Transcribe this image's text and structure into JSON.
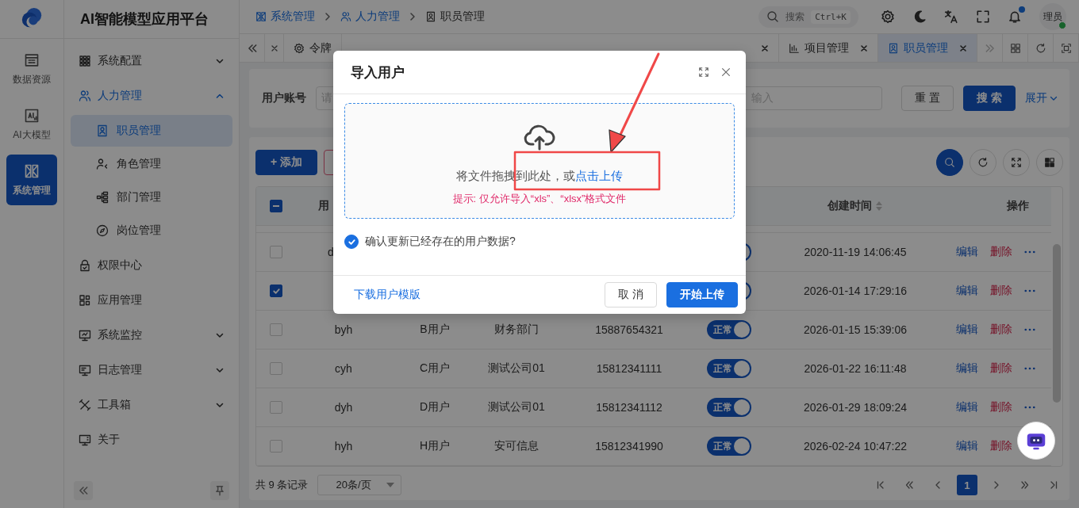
{
  "app": {
    "title": "AI智能模型应用平台"
  },
  "rail": [
    {
      "label": "数据资源",
      "selected": false
    },
    {
      "label": "AI大模型",
      "selected": false
    },
    {
      "label": "系统管理",
      "selected": true
    }
  ],
  "menu": [
    {
      "label": "系统配置",
      "selected": false,
      "expanded": false
    },
    {
      "label": "人力管理",
      "selected": true,
      "expanded": true,
      "children": [
        {
          "label": "职员管理",
          "selected": true
        },
        {
          "label": "角色管理",
          "selected": false
        },
        {
          "label": "部门管理",
          "selected": false
        },
        {
          "label": "岗位管理",
          "selected": false
        }
      ]
    },
    {
      "label": "权限中心",
      "selected": false
    },
    {
      "label": "应用管理",
      "selected": false
    },
    {
      "label": "系统监控",
      "selected": false,
      "expanded": false
    },
    {
      "label": "日志管理",
      "selected": false,
      "expanded": false
    },
    {
      "label": "工具箱",
      "selected": false,
      "expanded": false
    },
    {
      "label": "关于",
      "selected": false
    }
  ],
  "breadcrumbs": [
    "系统管理",
    "人力管理",
    "职员管理"
  ],
  "header": {
    "search_label": "搜索",
    "shortcut": "Ctrl+K",
    "notification_dot": true,
    "avatar": "理员",
    "online": true
  },
  "tabs": [
    {
      "label": "令牌",
      "selected": false,
      "closable": false
    },
    {
      "selected": false,
      "closable": true
    },
    {
      "label": "项目管理",
      "selected": false,
      "closable": true
    },
    {
      "label": "职员管理",
      "selected": true,
      "closable": true
    }
  ],
  "filters": {
    "account_label": "用户账号",
    "account_placeholder": "请",
    "field_2_placeholder": "输入",
    "reset": "重 置",
    "search": "搜 索",
    "expand": "展开"
  },
  "toolbar": {
    "add": "+ 添加"
  },
  "table": {
    "partially_selected": true,
    "column_account": "用",
    "column_created": "创建时间",
    "column_actions": "操作",
    "rows": [
      {
        "checked": false,
        "account": "d",
        "status": {
          "on": true
        },
        "created": "2020-11-19 14:06:45",
        "edit": "编辑",
        "delete": "删除"
      },
      {
        "checked": true,
        "status": {
          "on": true
        },
        "created": "2026-01-14 17:29:16",
        "edit": "编辑",
        "delete": "删除"
      },
      {
        "checked": false,
        "account": "byh",
        "name": "B用户",
        "dept": "财务部门",
        "phone": "15887654321",
        "status": {
          "on": true,
          "label": "正常"
        },
        "created": "2026-01-15 15:39:06",
        "edit": "编辑",
        "delete": "删除"
      },
      {
        "checked": false,
        "account": "cyh",
        "name": "C用户",
        "dept": "测试公司01",
        "phone": "15812341111",
        "status": {
          "on": true,
          "label": "正常"
        },
        "created": "2026-01-22 16:11:48",
        "edit": "编辑",
        "delete": "删除"
      },
      {
        "checked": false,
        "account": "dyh",
        "name": "D用户",
        "dept": "测试公司01",
        "phone": "15812341112",
        "status": {
          "on": true,
          "label": "正常"
        },
        "created": "2026-01-29 18:09:24",
        "edit": "编辑",
        "delete": "删除"
      },
      {
        "checked": false,
        "account": "hyh",
        "name": "H用户",
        "dept": "安可信息",
        "phone": "15812341990",
        "status": {
          "on": true,
          "label": "正常"
        },
        "created": "2026-02-24 10:47:22",
        "edit": "编辑",
        "delete": "删除"
      }
    ]
  },
  "pagination": {
    "total": "共 9 条记录",
    "page_size": "20条/页",
    "pages": [
      {
        "label": "1",
        "selected": true
      }
    ]
  },
  "dialog": {
    "title": "导入用户",
    "drop_text": "将文件拖拽到此处，或",
    "drop_link": "点击上传",
    "hint": "提示: 仅允许导入“xls”、“xlsx”格式文件",
    "update_existing": {
      "label": "确认更新已经存在的用户数据?",
      "checked": true
    },
    "template_link": "下载用户模版",
    "cancel": "取 消",
    "submit": "开始上传"
  },
  "annotation": {
    "arrow": true,
    "highlight": true
  }
}
